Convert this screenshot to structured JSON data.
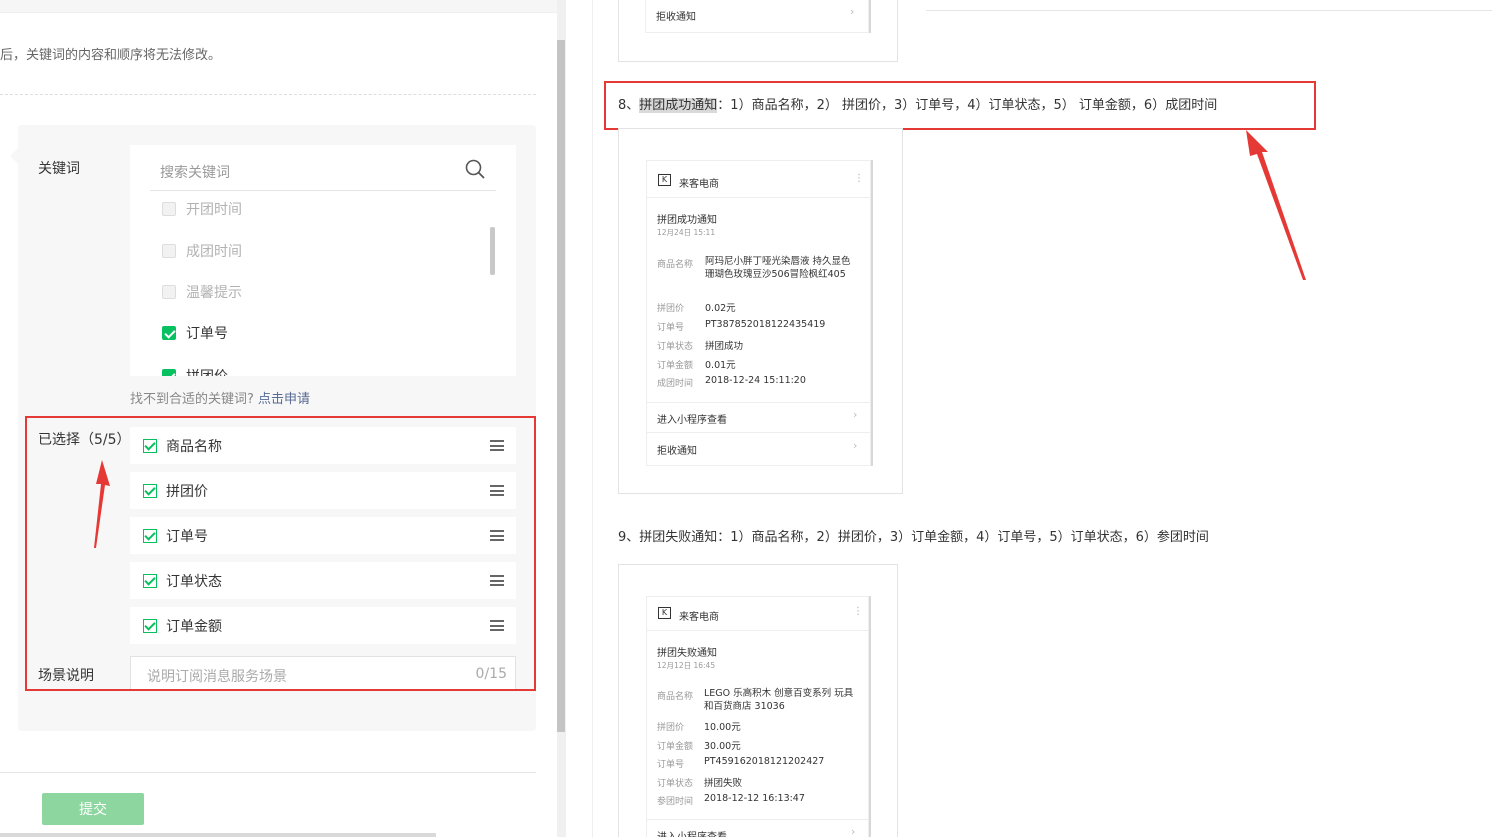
{
  "left": {
    "note": "后，关键词的内容和顺序将无法修改。",
    "keywords_label": "关键词",
    "search_placeholder": "搜索关键词",
    "keyword_list": [
      {
        "label": "开团时间",
        "checked": false
      },
      {
        "label": "成团时间",
        "checked": false
      },
      {
        "label": "温馨提示",
        "checked": false
      },
      {
        "label": "订单号",
        "checked": true
      },
      {
        "label": "拼团价",
        "checked": true
      }
    ],
    "hint_text": "找不到合适的关键词?",
    "hint_link": "点击申请",
    "selected_label": "已选择（5/5）",
    "selected": [
      "商品名称",
      "拼团价",
      "订单号",
      "订单状态",
      "订单金额"
    ],
    "scene_label": "场景说明",
    "scene_placeholder": "说明订阅消息服务场景",
    "scene_count": "0/15",
    "submit_label": "提交"
  },
  "right": {
    "top_card_text": "拒收通知",
    "item8": {
      "num": "8、",
      "name": "拼团成功通知",
      "rest": "：1）商品名称，2） 拼团价，3）订单号，4）订单状态，5） 订单金额，6）成团时间"
    },
    "card1": {
      "brand": "来客电商",
      "title": "拼团成功通知",
      "date": "12月24日 15:11",
      "fields": [
        {
          "k": "商品名称",
          "v": "阿玛尼小胖丁哑光染唇液 持久显色 珊瑚色玫瑰豆沙506冒险枫红405"
        },
        {
          "k": "拼团价",
          "v": "0.02元"
        },
        {
          "k": "订单号",
          "v": "PT387852018122435419"
        },
        {
          "k": "订单状态",
          "v": "拼团成功"
        },
        {
          "k": "订单金额",
          "v": "0.01元"
        },
        {
          "k": "成团时间",
          "v": "2018-12-24 15:11:20"
        }
      ],
      "link1": "进入小程序查看",
      "link2": "拒收通知"
    },
    "item9": "9、拼团失败通知：1）商品名称，2）拼团价，3）订单金额，4）订单号，5）订单状态，6）参团时间",
    "card2": {
      "brand": "来客电商",
      "title": "拼团失败通知",
      "date": "12月12日 16:45",
      "fields": [
        {
          "k": "商品名称",
          "v": "LEGO 乐高积木 创意百变系列 玩具和百货商店 31036"
        },
        {
          "k": "拼团价",
          "v": "10.00元"
        },
        {
          "k": "订单金额",
          "v": "30.00元"
        },
        {
          "k": "订单号",
          "v": "PT459162018121202427"
        },
        {
          "k": "订单状态",
          "v": "拼团失败"
        },
        {
          "k": "参团时间",
          "v": "2018-12-12 16:13:47"
        }
      ],
      "link1": "进入小程序查看"
    }
  },
  "colors": {
    "accent": "#07c160",
    "annotation": "#e53935",
    "link": "#576b95",
    "submit_disabled": "#8ed6a0"
  }
}
